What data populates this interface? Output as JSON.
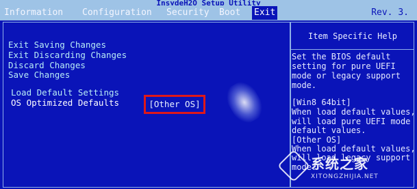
{
  "header": {
    "utility_title": "InsydeH2O Setup Utility",
    "revision": "Rev. 3."
  },
  "menu": [
    {
      "label": "Information"
    },
    {
      "label": "Configuration"
    },
    {
      "label": "Security"
    },
    {
      "label": "Boot"
    },
    {
      "label": "Exit"
    }
  ],
  "exit_options": [
    {
      "label": "Exit Saving Changes"
    },
    {
      "label": "Exit Discarding Changes"
    },
    {
      "label": "Discard Changes"
    },
    {
      "label": "Save Changes"
    },
    {
      "label": "Load Default Settings"
    },
    {
      "label": "OS Optimized Defaults",
      "value": "[Other OS]"
    }
  ],
  "help": {
    "title": "Item Specific Help",
    "lines": [
      "Set the BIOS default",
      "setting for pure UEFI",
      "mode or legacy support",
      "mode.",
      "",
      "[Win8 64bit]",
      "When load default values,",
      " will load pure UEFI mode",
      " default values.",
      "[Other OS]",
      "When load default values,",
      " will load legacy support",
      " mode."
    ]
  },
  "watermark": {
    "brand": "系统之家",
    "url": "XITONGZHIJIA.NET"
  },
  "colors": {
    "background": "#0a14b8",
    "menubar": "#9ec3e6",
    "option_text": "#b8ecf6",
    "highlight_border": "#e01818"
  }
}
